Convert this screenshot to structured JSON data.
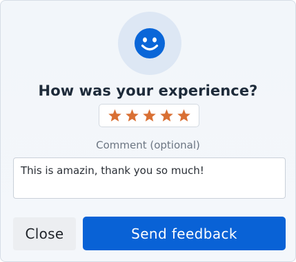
{
  "dialog": {
    "title": "How was your experience?",
    "icon": "smiley-face-icon",
    "rating": {
      "value": 5,
      "max": 5,
      "star_color": "#d97034"
    },
    "comment_label": "Comment (optional)",
    "comment_value": "This is amazin, thank you so much!",
    "close_label": "Close",
    "send_label": "Send feedback",
    "accent_color": "#0962d6"
  }
}
